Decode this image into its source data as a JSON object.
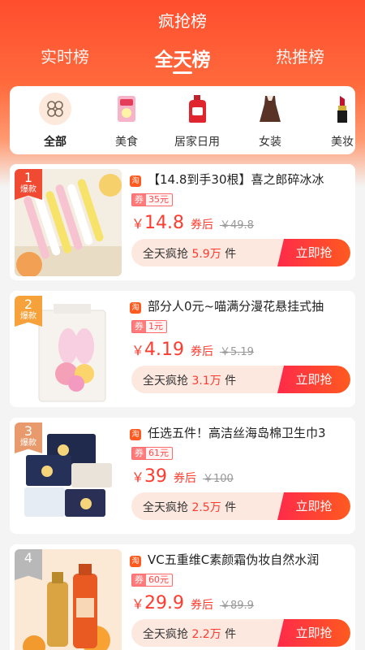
{
  "header": {
    "title": "疯抢榜"
  },
  "tabs": [
    {
      "label": "实时榜"
    },
    {
      "label": "全天榜"
    },
    {
      "label": "热推榜"
    }
  ],
  "categories": [
    {
      "label": "全部",
      "icon": "clover-icon"
    },
    {
      "label": "美食",
      "icon": "snack-icon"
    },
    {
      "label": "居家日用",
      "icon": "detergent-icon"
    },
    {
      "label": "女装",
      "icon": "dress-icon"
    },
    {
      "label": "美妆",
      "icon": "lipstick-icon"
    }
  ],
  "products": [
    {
      "rank": "1",
      "rank_tag": "爆款",
      "platform": "淘",
      "title": "【14.8到手30根】喜之郎碎冰冰",
      "coupon_tag": "券",
      "coupon": "35元",
      "currency": "￥",
      "price": "14.8",
      "after_coupon": "券后",
      "original": "￥49.8",
      "promo_prefix": "全天疯抢",
      "sold": "5.9万",
      "unit": "件",
      "button": "立即抢"
    },
    {
      "rank": "2",
      "rank_tag": "爆款",
      "platform": "淘",
      "title": "部分人0元~喵满分漫花悬挂式抽",
      "coupon_tag": "券",
      "coupon": "1元",
      "currency": "￥",
      "price": "4.19",
      "after_coupon": "券后",
      "original": "￥5.19",
      "promo_prefix": "全天疯抢",
      "sold": "3.1万",
      "unit": "件",
      "button": "立即抢"
    },
    {
      "rank": "3",
      "rank_tag": "爆款",
      "platform": "淘",
      "title": "任选五件！高洁丝海岛棉卫生巾3",
      "coupon_tag": "券",
      "coupon": "61元",
      "currency": "￥",
      "price": "39",
      "after_coupon": "券后",
      "original": "￥100",
      "promo_prefix": "全天疯抢",
      "sold": "2.5万",
      "unit": "件",
      "button": "立即抢"
    },
    {
      "rank": "4",
      "rank_tag": "",
      "platform": "淘",
      "title": "VC五重维C素颜霜伪妆自然水润",
      "coupon_tag": "券",
      "coupon": "60元",
      "currency": "￥",
      "price": "29.9",
      "after_coupon": "券后",
      "original": "￥89.9",
      "promo_prefix": "全天疯抢",
      "sold": "2.2万",
      "unit": "件",
      "button": "立即抢"
    }
  ],
  "colors": {
    "accent": "#ff3b2f",
    "header": "#ff5a34"
  }
}
